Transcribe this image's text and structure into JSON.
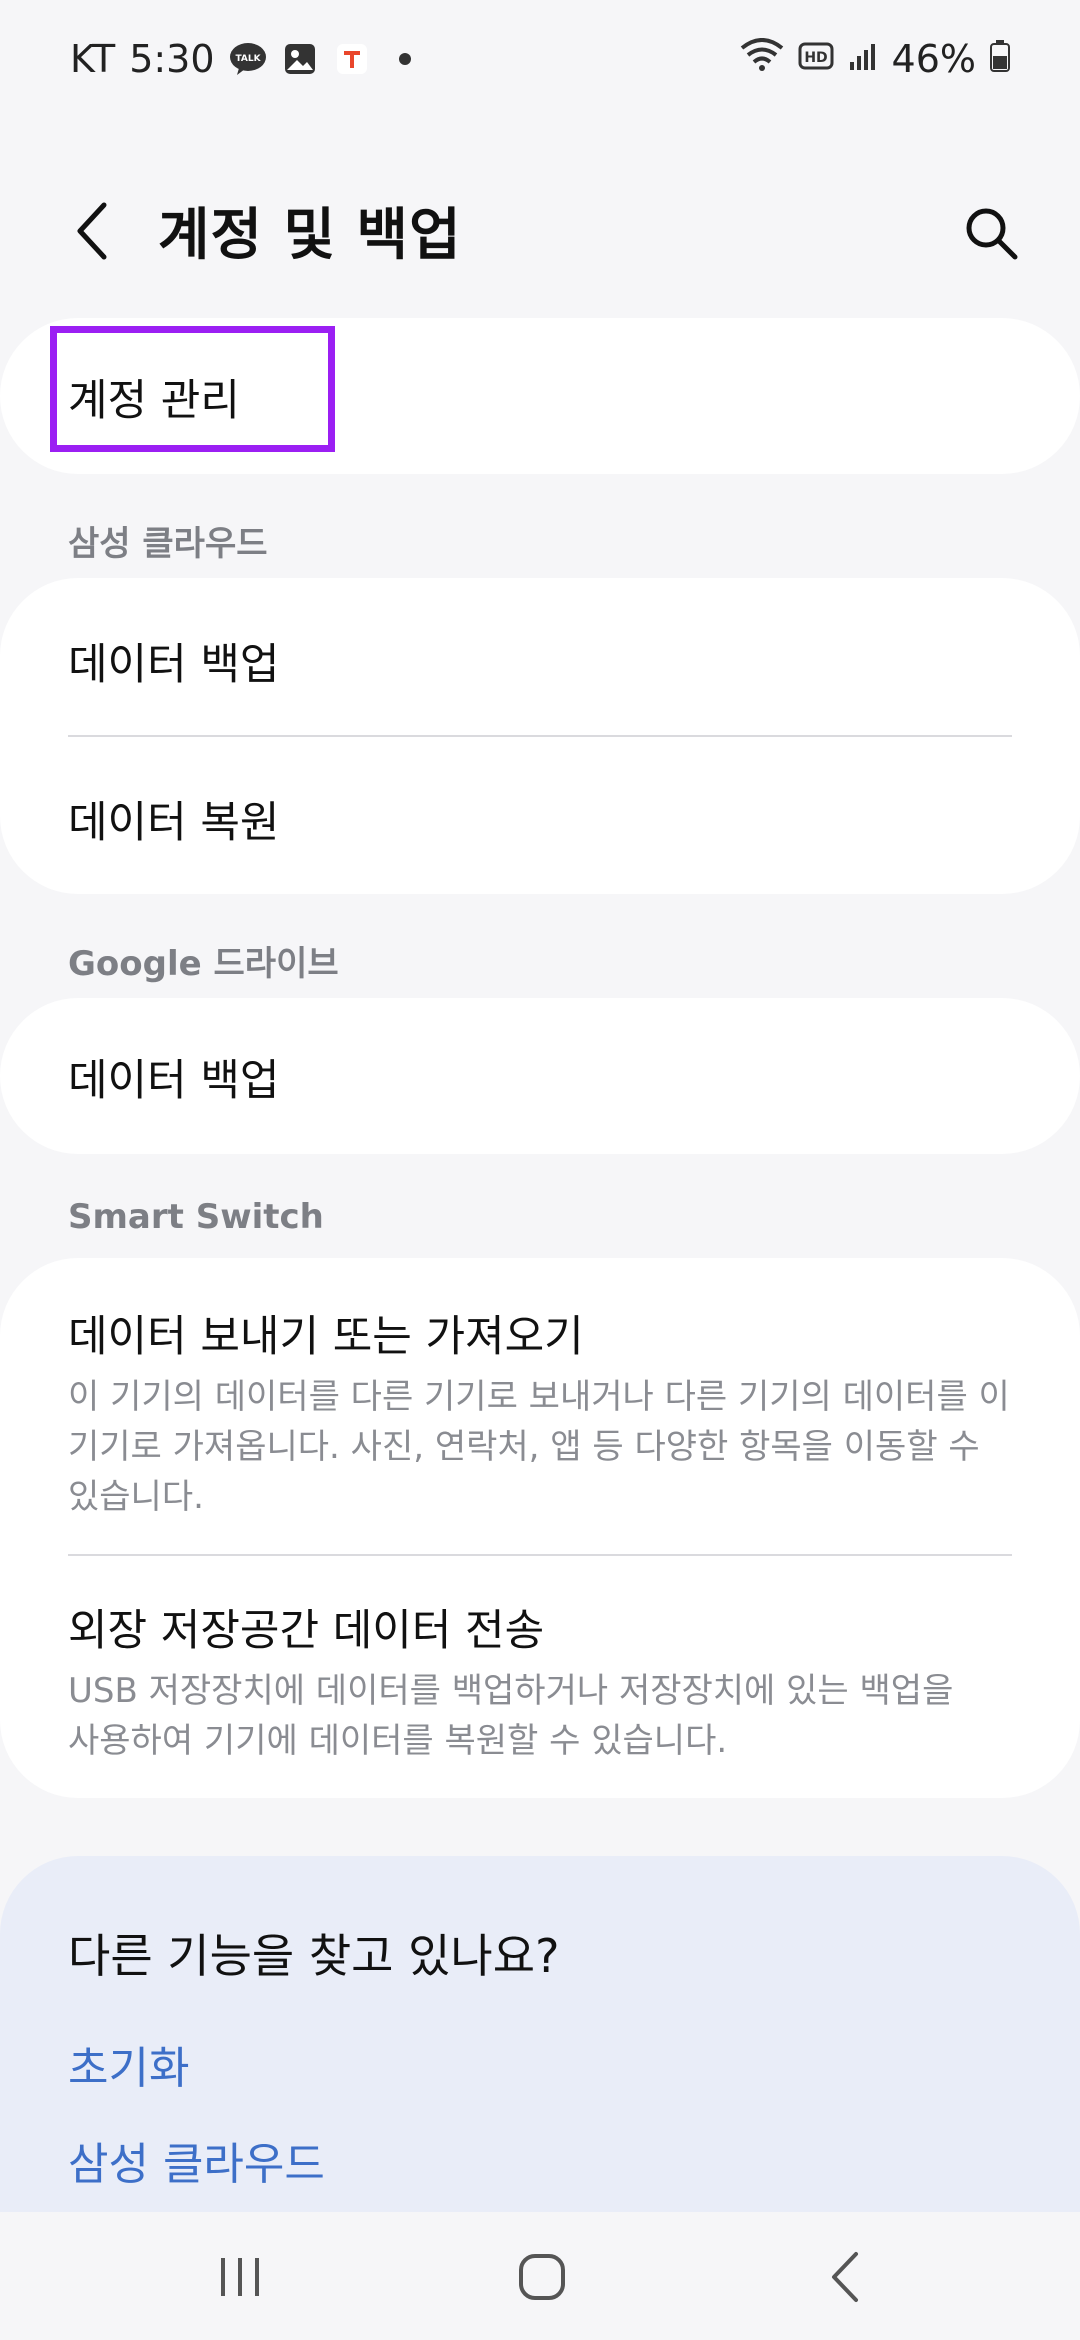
{
  "status_bar": {
    "carrier": "KT",
    "time": "5:30",
    "talk_badge": "TALK",
    "battery": "46%"
  },
  "header": {
    "title": "계정 및 백업"
  },
  "account": {
    "manage_label": "계정 관리"
  },
  "samsung_cloud": {
    "header": "삼성 클라우드",
    "items": [
      {
        "label": "데이터 백업"
      },
      {
        "label": "데이터 복원"
      }
    ]
  },
  "google_drive": {
    "header": "Google 드라이브",
    "items": [
      {
        "label": "데이터 백업"
      }
    ]
  },
  "smart_switch": {
    "header": "Smart Switch",
    "items": [
      {
        "label": "데이터 보내기 또는 가져오기",
        "desc_lines": [
          "이 기기의 데이터를 다른 기기로 보내거나 다른 기기의 데이터를 이",
          "기기로 가져옵니다. 사진, 연락처, 앱 등 다양한 항목을 이동할 수",
          "있습니다."
        ]
      },
      {
        "label": "외장 저장공간 데이터 전송",
        "desc_lines": [
          "USB 저장장치에 데이터를 백업하거나 저장장치에 있는 백업을",
          "사용하여 기기에 데이터를 복원할 수 있습니다."
        ]
      }
    ]
  },
  "suggestions": {
    "title": "다른 기능을 찾고 있나요?",
    "links": [
      "초기화",
      "삼성 클라우드"
    ]
  },
  "colors": {
    "background": "#f6f6f8",
    "card": "#ffffff",
    "section_header": "#7d7f85",
    "link": "#3d6fc8",
    "highlight": "#9b1ff3",
    "suggest_bg": "#e9edf8"
  }
}
